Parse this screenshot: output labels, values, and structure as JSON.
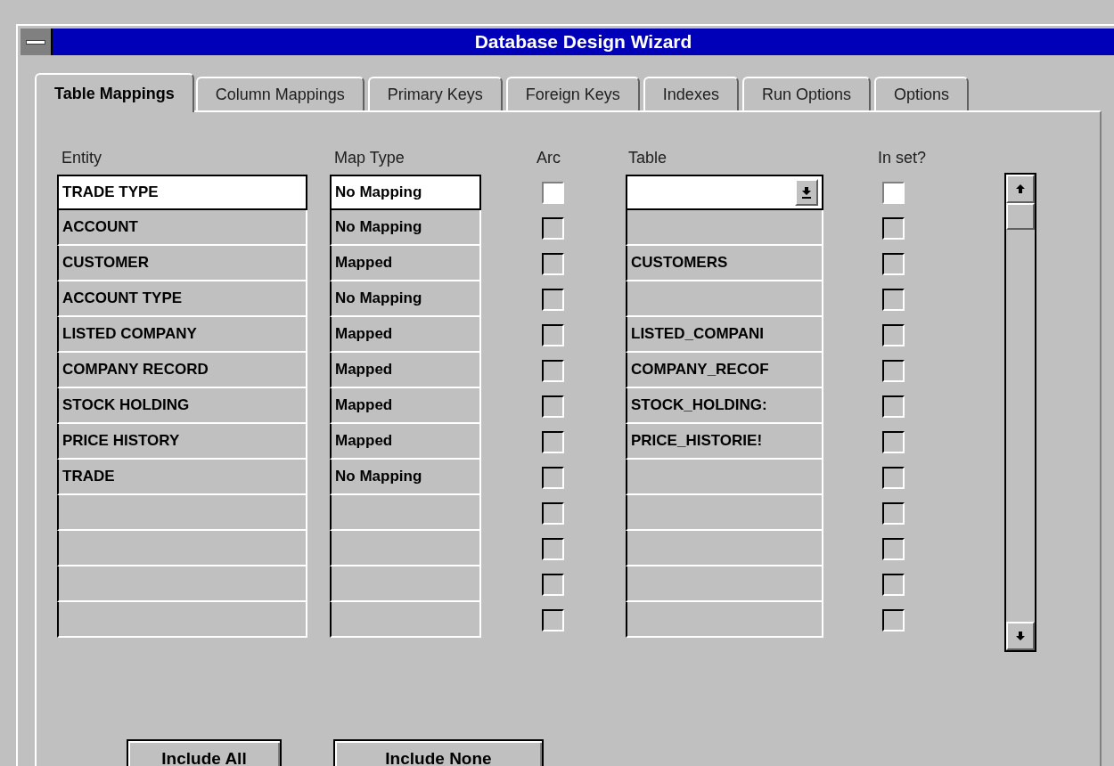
{
  "window": {
    "title": "Database Design Wizard"
  },
  "tabs": [
    {
      "label": "Table Mappings",
      "selected": true
    },
    {
      "label": "Column Mappings",
      "selected": false
    },
    {
      "label": "Primary Keys",
      "selected": false
    },
    {
      "label": "Foreign Keys",
      "selected": false
    },
    {
      "label": "Indexes",
      "selected": false
    },
    {
      "label": "Run Options",
      "selected": false
    },
    {
      "label": "Options",
      "selected": false
    }
  ],
  "columns": [
    "Entity",
    "Map Type",
    "Arc",
    "Table",
    "In set?"
  ],
  "rows": [
    {
      "entity": "TRADE TYPE",
      "map_type": "No Mapping",
      "arc": false,
      "in_set": false,
      "selected": true
    },
    {
      "entity": "ACCOUNT",
      "map_type": "No Mapping",
      "arc": false,
      "in_set": false,
      "selected": false
    },
    {
      "entity": "CUSTOMER",
      "map_type": "Mapped",
      "arc": false,
      "table": "CUSTOMERS",
      "in_set": false,
      "selected": false
    },
    {
      "entity": "ACCOUNT TYPE",
      "map_type": "No Mapping",
      "arc": false,
      "in_set": false,
      "selected": false
    },
    {
      "entity": "LISTED COMPANY",
      "map_type": "Mapped",
      "arc": false,
      "table": "LISTED_COMPANI",
      "in_set": false,
      "selected": false
    },
    {
      "entity": "COMPANY RECORD",
      "map_type": "Mapped",
      "arc": false,
      "table": "COMPANY_RECOF",
      "in_set": false,
      "selected": false
    },
    {
      "entity": "STOCK HOLDING",
      "map_type": "Mapped",
      "arc": false,
      "table": "STOCK_HOLDING:",
      "in_set": false,
      "selected": false
    },
    {
      "entity": "PRICE HISTORY",
      "map_type": "Mapped",
      "arc": false,
      "table": "PRICE_HISTORIE!",
      "in_set": false,
      "selected": false
    },
    {
      "entity": "TRADE",
      "map_type": "No Mapping",
      "arc": false,
      "in_set": false,
      "selected": false
    },
    {
      "arc": false,
      "in_set": false,
      "selected": false
    },
    {
      "arc": false,
      "in_set": false,
      "selected": false
    },
    {
      "arc": false,
      "in_set": false,
      "selected": false
    },
    {
      "arc": false,
      "in_set": false,
      "selected": false
    }
  ],
  "buttons": [
    "Include All",
    "Include None"
  ]
}
